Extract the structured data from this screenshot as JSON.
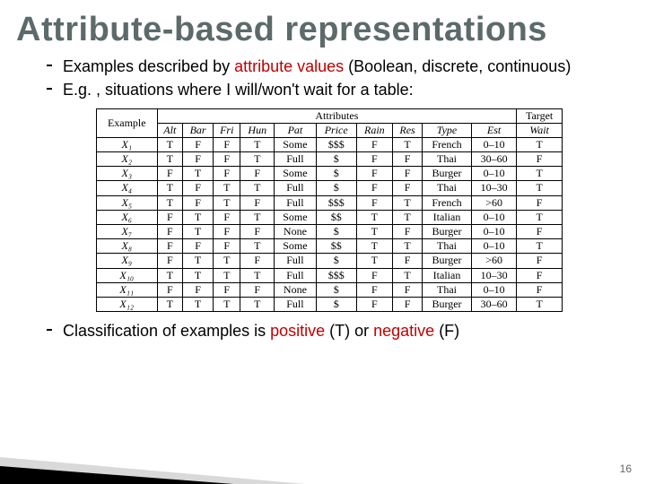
{
  "title": "Attribute-based representations",
  "bullets": {
    "b1_pre": "Examples described by ",
    "b1_kw": "attribute values",
    "b1_post": " (Boolean, discrete, continuous)",
    "b2": "E.g. , situations where I will/won't wait for a table:",
    "b3_pre": "Classification of examples is ",
    "b3_kw1": "positive",
    "b3_mid1": " (T) or ",
    "b3_kw2": "negative",
    "b3_mid2": " (F)"
  },
  "table": {
    "head_example": "Example",
    "head_attributes": "Attributes",
    "head_target": "Target",
    "cols": [
      "Alt",
      "Bar",
      "Fri",
      "Hun",
      "Pat",
      "Price",
      "Rain",
      "Res",
      "Type",
      "Est"
    ],
    "target_col": "Wait",
    "rows": [
      {
        "ex": "X₁",
        "vals": [
          "T",
          "F",
          "F",
          "T",
          "Some",
          "$$$",
          "F",
          "T",
          "French",
          "0–10"
        ],
        "tgt": "T"
      },
      {
        "ex": "X₂",
        "vals": [
          "T",
          "F",
          "F",
          "T",
          "Full",
          "$",
          "F",
          "F",
          "Thai",
          "30–60"
        ],
        "tgt": "F"
      },
      {
        "ex": "X₃",
        "vals": [
          "F",
          "T",
          "F",
          "F",
          "Some",
          "$",
          "F",
          "F",
          "Burger",
          "0–10"
        ],
        "tgt": "T"
      },
      {
        "ex": "X₄",
        "vals": [
          "T",
          "F",
          "T",
          "T",
          "Full",
          "$",
          "F",
          "F",
          "Thai",
          "10–30"
        ],
        "tgt": "T"
      },
      {
        "ex": "X₅",
        "vals": [
          "T",
          "F",
          "T",
          "F",
          "Full",
          "$$$",
          "F",
          "T",
          "French",
          ">60"
        ],
        "tgt": "F"
      },
      {
        "ex": "X₆",
        "vals": [
          "F",
          "T",
          "F",
          "T",
          "Some",
          "$$",
          "T",
          "T",
          "Italian",
          "0–10"
        ],
        "tgt": "T"
      },
      {
        "ex": "X₇",
        "vals": [
          "F",
          "T",
          "F",
          "F",
          "None",
          "$",
          "T",
          "F",
          "Burger",
          "0–10"
        ],
        "tgt": "F"
      },
      {
        "ex": "X₈",
        "vals": [
          "F",
          "F",
          "F",
          "T",
          "Some",
          "$$",
          "T",
          "T",
          "Thai",
          "0–10"
        ],
        "tgt": "T"
      },
      {
        "ex": "X₉",
        "vals": [
          "F",
          "T",
          "T",
          "F",
          "Full",
          "$",
          "T",
          "F",
          "Burger",
          ">60"
        ],
        "tgt": "F"
      },
      {
        "ex": "X₁₀",
        "vals": [
          "T",
          "T",
          "T",
          "T",
          "Full",
          "$$$",
          "F",
          "T",
          "Italian",
          "10–30"
        ],
        "tgt": "F"
      },
      {
        "ex": "X₁₁",
        "vals": [
          "F",
          "F",
          "F",
          "F",
          "None",
          "$",
          "F",
          "F",
          "Thai",
          "0–10"
        ],
        "tgt": "F"
      },
      {
        "ex": "X₁₂",
        "vals": [
          "T",
          "T",
          "T",
          "T",
          "Full",
          "$",
          "F",
          "F",
          "Burger",
          "30–60"
        ],
        "tgt": "T"
      }
    ]
  },
  "pagenum": "16"
}
